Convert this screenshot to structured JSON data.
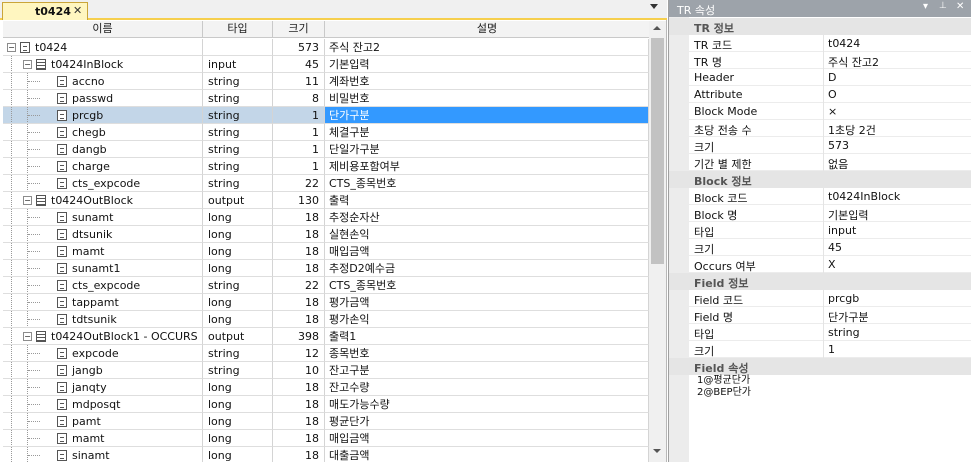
{
  "tab": {
    "title": "t0424",
    "close": "✕"
  },
  "grid": {
    "headers": {
      "name": "이름",
      "type": "타입",
      "size": "크기",
      "desc": "설명"
    },
    "rows": [
      {
        "depth": 0,
        "kind": "root",
        "toggle": "−",
        "name": "t0424",
        "type": "",
        "size": "573",
        "desc": "주식 잔고2"
      },
      {
        "depth": 1,
        "kind": "block",
        "toggle": "−",
        "name": "t0424InBlock",
        "type": "input",
        "size": "45",
        "desc": "기본입력"
      },
      {
        "depth": 2,
        "kind": "field",
        "name": "accno",
        "type": "string",
        "size": "11",
        "desc": "계좌번호"
      },
      {
        "depth": 2,
        "kind": "field",
        "name": "passwd",
        "type": "string",
        "size": "8",
        "desc": "비밀번호"
      },
      {
        "depth": 2,
        "kind": "field",
        "name": "prcgb",
        "type": "string",
        "size": "1",
        "desc": "단가구분",
        "selected": true
      },
      {
        "depth": 2,
        "kind": "field",
        "name": "chegb",
        "type": "string",
        "size": "1",
        "desc": "체결구분"
      },
      {
        "depth": 2,
        "kind": "field",
        "name": "dangb",
        "type": "string",
        "size": "1",
        "desc": "단일가구분"
      },
      {
        "depth": 2,
        "kind": "field",
        "name": "charge",
        "type": "string",
        "size": "1",
        "desc": "제비용포함여부"
      },
      {
        "depth": 2,
        "kind": "field",
        "name": "cts_expcode",
        "type": "string",
        "size": "22",
        "desc": "CTS_종목번호"
      },
      {
        "depth": 1,
        "kind": "block",
        "toggle": "−",
        "name": "t0424OutBlock",
        "type": "output",
        "size": "130",
        "desc": "출력"
      },
      {
        "depth": 2,
        "kind": "field",
        "name": "sunamt",
        "type": "long",
        "size": "18",
        "desc": "추정순자산"
      },
      {
        "depth": 2,
        "kind": "field",
        "name": "dtsunik",
        "type": "long",
        "size": "18",
        "desc": "실현손익"
      },
      {
        "depth": 2,
        "kind": "field",
        "name": "mamt",
        "type": "long",
        "size": "18",
        "desc": "매입금액"
      },
      {
        "depth": 2,
        "kind": "field",
        "name": "sunamt1",
        "type": "long",
        "size": "18",
        "desc": "추정D2예수금"
      },
      {
        "depth": 2,
        "kind": "field",
        "name": "cts_expcode",
        "type": "string",
        "size": "22",
        "desc": "CTS_종목번호"
      },
      {
        "depth": 2,
        "kind": "field",
        "name": "tappamt",
        "type": "long",
        "size": "18",
        "desc": "평가금액"
      },
      {
        "depth": 2,
        "kind": "field",
        "name": "tdtsunik",
        "type": "long",
        "size": "18",
        "desc": "평가손익"
      },
      {
        "depth": 1,
        "kind": "block",
        "toggle": "−",
        "name": "t0424OutBlock1 - OCCURS",
        "type": "output",
        "size": "398",
        "desc": "출력1"
      },
      {
        "depth": 2,
        "kind": "field",
        "name": "expcode",
        "type": "string",
        "size": "12",
        "desc": "종목번호"
      },
      {
        "depth": 2,
        "kind": "field",
        "name": "jangb",
        "type": "string",
        "size": "10",
        "desc": "잔고구분"
      },
      {
        "depth": 2,
        "kind": "field",
        "name": "janqty",
        "type": "long",
        "size": "18",
        "desc": "잔고수량"
      },
      {
        "depth": 2,
        "kind": "field",
        "name": "mdposqt",
        "type": "long",
        "size": "18",
        "desc": "매도가능수량"
      },
      {
        "depth": 2,
        "kind": "field",
        "name": "pamt",
        "type": "long",
        "size": "18",
        "desc": "평균단가"
      },
      {
        "depth": 2,
        "kind": "field",
        "name": "mamt",
        "type": "long",
        "size": "18",
        "desc": "매입금액"
      },
      {
        "depth": 2,
        "kind": "field",
        "name": "sinamt",
        "type": "long",
        "size": "18",
        "desc": "대출금액"
      }
    ]
  },
  "props": {
    "title": "TR 속성",
    "controls": {
      "dropdown": "▾",
      "pin": "📌",
      "close": "✕"
    },
    "sections": [
      {
        "title": "TR 정보",
        "items": [
          {
            "k": "TR 코드",
            "v": "t0424"
          },
          {
            "k": "TR 명",
            "v": "주식 잔고2"
          },
          {
            "k": "Header",
            "v": "D"
          },
          {
            "k": "Attribute",
            "v": "O"
          },
          {
            "k": "Block Mode",
            "v": "×"
          },
          {
            "k": "초당 전송 수",
            "v": "1초당 2건"
          },
          {
            "k": "크기",
            "v": "573"
          },
          {
            "k": "기간 별 제한",
            "v": "없음"
          }
        ]
      },
      {
        "title": "Block 정보",
        "items": [
          {
            "k": "Block 코드",
            "v": "t0424InBlock"
          },
          {
            "k": "Block 명",
            "v": "기본입력"
          },
          {
            "k": "타입",
            "v": "input"
          },
          {
            "k": "크기",
            "v": "45"
          },
          {
            "k": "Occurs 여부",
            "v": "X"
          }
        ]
      },
      {
        "title": "Field 정보",
        "items": [
          {
            "k": "Field 코드",
            "v": "prcgb"
          },
          {
            "k": "Field 명",
            "v": "단가구분"
          },
          {
            "k": "타입",
            "v": "string"
          },
          {
            "k": "크기",
            "v": "1"
          }
        ]
      },
      {
        "title": "Field 속성",
        "items": []
      }
    ],
    "attributes": [
      "1@평균단가",
      "2@BEP단가"
    ]
  },
  "colors": {
    "tab_accent": "#f6cf4d",
    "selection": "#3399ff",
    "selection_row": "#c3d6e8",
    "panel_title": "#9da3aa"
  }
}
